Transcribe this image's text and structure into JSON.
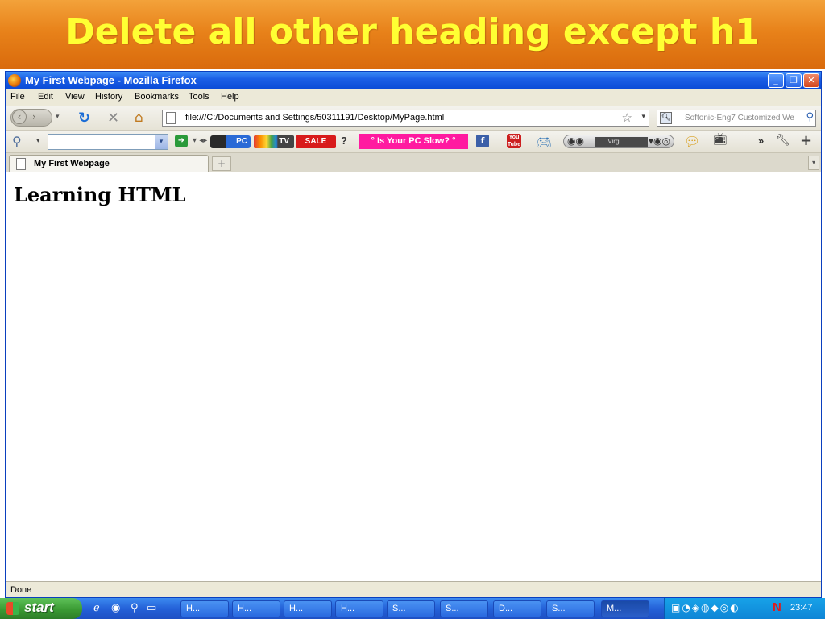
{
  "slide": {
    "title": "Delete all other heading except h1"
  },
  "window": {
    "title": "My First Webpage - Mozilla Firefox",
    "buttons": {
      "minimize": "_",
      "maximize": "❐",
      "close": "✕"
    }
  },
  "menubar": {
    "items": [
      "File",
      "Edit",
      "View",
      "History",
      "Bookmarks",
      "Tools",
      "Help"
    ]
  },
  "navbar": {
    "url": "file:///C:/Documents and Settings/50311191/Desktop/MyPage.html",
    "search_placeholder": "Softonic-Eng7 Customized We"
  },
  "toolbar2": {
    "pc_label": "PC",
    "tv_label": "TV",
    "sale_label": "SALE",
    "help_label": "?",
    "slow_label": "° Is Your PC Slow? °",
    "youtube_label": "You Tube",
    "player_track": "..... Virgi...",
    "more_label": "»"
  },
  "tabs": {
    "active_label": "My First Webpage",
    "new_tab": "+"
  },
  "page": {
    "h1": "Learning HTML"
  },
  "status": {
    "text": "Done"
  },
  "taskbar": {
    "start_label": "start",
    "tasks": [
      "H...",
      "H...",
      "H...",
      "H...",
      "S...",
      "S...",
      "D...",
      "S...",
      "M..."
    ],
    "clock": "23:47",
    "tray_letter": "N"
  },
  "colors": {
    "banner": "#e8821a",
    "banner_text": "#ffff33",
    "titlebar": "#0a4ad6",
    "taskbar": "#2461d8"
  }
}
